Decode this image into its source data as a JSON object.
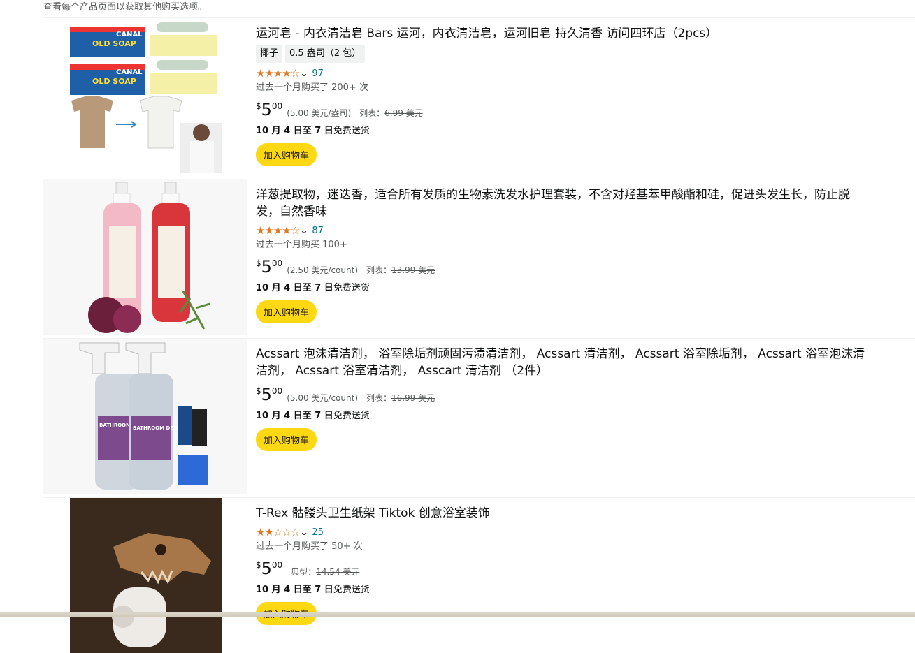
{
  "top_note": "查看每个产品页面以获取其他购买选项。",
  "products": [
    {
      "title": "运河皂 - 内衣清洁皂 Bars 运河，内衣清洁皂，运河旧皂 持久清香 访问四环店（2pcs）",
      "variants": [
        "椰子",
        "0.5 盎司（2 包）"
      ],
      "stars": "★★★★☆",
      "rating_count": "97",
      "bought": "过去一个月购买了 200+ 次",
      "price_symbol": "$",
      "price_whole": "5",
      "price_fraction": "00",
      "unit_price": "(5.00 美元/盎司)",
      "list_label": "列表：",
      "list_price": "6.99 美元",
      "delivery_date": "10 月 4 日至 7 日",
      "delivery_text": "免费送货",
      "cart_label": "加入购物车"
    },
    {
      "title": "洋葱提取物，迷迭香，适合所有发质的生物素洗发水护理套装，不含对羟基苯甲酸酯和硅，促进头发生长，防止脱发，自然香味",
      "stars": "★★★★☆",
      "rating_count": "87",
      "bought": "过去一个月购买 100+",
      "price_symbol": "$",
      "price_whole": "5",
      "price_fraction": "00",
      "unit_price": "(2.50 美元/count)",
      "list_label": "列表：",
      "list_price": "13.99 美元",
      "delivery_date": "10 月 4 日至 7 日",
      "delivery_text": "免费送货",
      "cart_label": "加入购物车"
    },
    {
      "title": "Acssart 泡沫清洁剂， 浴室除垢剂顽固污渍清洁剂， Acssart 清洁剂， Acssart 浴室除垢剂， Acssart 浴室泡沫清洁剂， Acssart 浴室清洁剂， Asscart 清洁剂 （2件）",
      "price_symbol": "$",
      "price_whole": "5",
      "price_fraction": "00",
      "unit_price": "(5.00 美元/count)",
      "list_label": "列表：",
      "list_price": "16.99 美元",
      "delivery_date": "10 月 4 日至 7 日",
      "delivery_text": "免费送货",
      "cart_label": "加入购物车"
    },
    {
      "title": "T-Rex 骷髅头卫生纸架 Tiktok 创意浴室装饰",
      "stars": "★★☆☆☆",
      "rating_count": "25",
      "bought": "过去一个月购买了 50+ 次",
      "price_symbol": "$",
      "price_whole": "5",
      "price_fraction": "00",
      "list_label": "典型：",
      "list_price": "14.54 美元",
      "delivery_date": "10 月 4 日至 7 日",
      "delivery_text": "免费送货",
      "cart_label": "加入购物车"
    }
  ],
  "image_labels": {
    "soap_brand": "CANAL",
    "soap_name": "OLD SOAP",
    "descaler_name": "BATHROOM DESCALER"
  },
  "colors": {
    "star": "#de7921",
    "link": "#007185",
    "cart_button": "#ffd814"
  }
}
